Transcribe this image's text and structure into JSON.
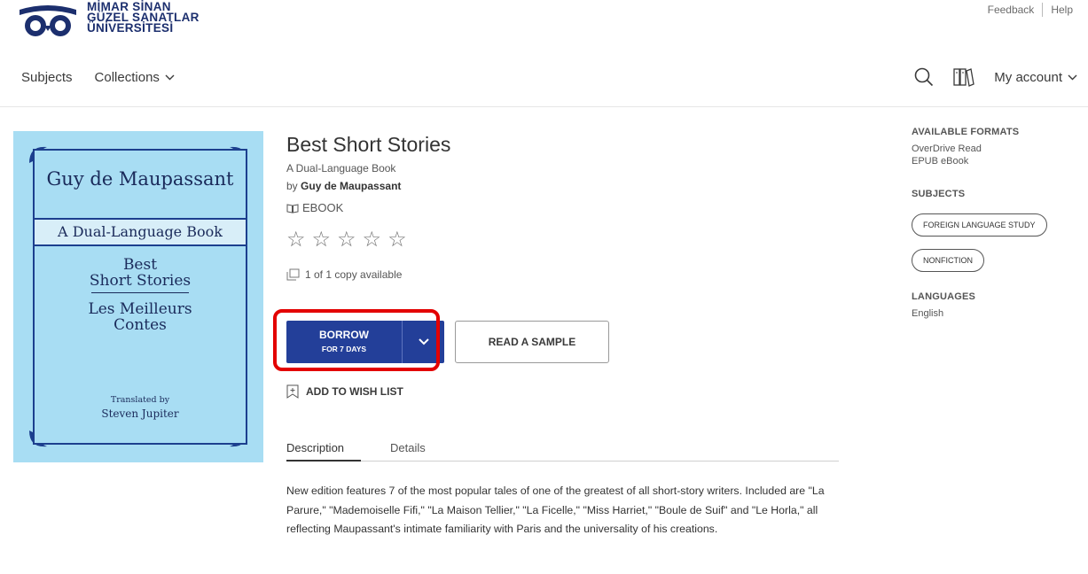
{
  "brand": {
    "line1": "MİMAR SİNAN",
    "line2": "GÜZEL SANATLAR",
    "line3": "ÜNİVERSİTESİ",
    "color": "#1c2f6e"
  },
  "util_links": {
    "feedback": "Feedback",
    "help": "Help"
  },
  "nav": {
    "subjects": "Subjects",
    "collections": "Collections",
    "account": "My account"
  },
  "cover": {
    "author": "Guy de Maupassant",
    "band": "A Dual-Language Book",
    "title_line1": "Best",
    "title_line2": "Short Stories",
    "title_line3": "Les Meilleurs",
    "title_line4": "Contes",
    "translated_by": "Translated by",
    "translator": "Steven Jupiter",
    "bg_color": "#a8ddf3"
  },
  "book": {
    "title": "Best Short Stories",
    "subtitle": "A Dual-Language Book",
    "by": "by",
    "author": "Guy de Maupassant",
    "format": "EBOOK",
    "rating": 0,
    "stars": "☆☆☆☆☆",
    "availability": "1 of 1 copy available"
  },
  "actions": {
    "borrow": "BORROW",
    "borrow_period": "FOR 7 DAYS",
    "sample": "READ A SAMPLE",
    "wishlist": "ADD TO WISH LIST",
    "accent": "#233f99",
    "highlight": "#e30000"
  },
  "tabs": {
    "description": "Description",
    "details": "Details"
  },
  "description": "New edition features 7 of the most popular tales of one of the greatest of all short-story writers. Included are \"La Parure,\" \"Mademoiselle Fifi,\" \"La Maison Tellier,\" \"La Ficelle,\" \"Miss Harriet,\" \"Boule de Suif\" and \"Le Horla,\" all reflecting Maupassant's intimate familiarity with Paris and the universality of his creations.",
  "sidebar": {
    "formats_heading": "AVAILABLE FORMATS",
    "formats": [
      "OverDrive Read",
      "EPUB eBook"
    ],
    "subjects_heading": "SUBJECTS",
    "subjects": [
      "FOREIGN LANGUAGE STUDY",
      "NONFICTION"
    ],
    "languages_heading": "LANGUAGES",
    "language": "English"
  }
}
